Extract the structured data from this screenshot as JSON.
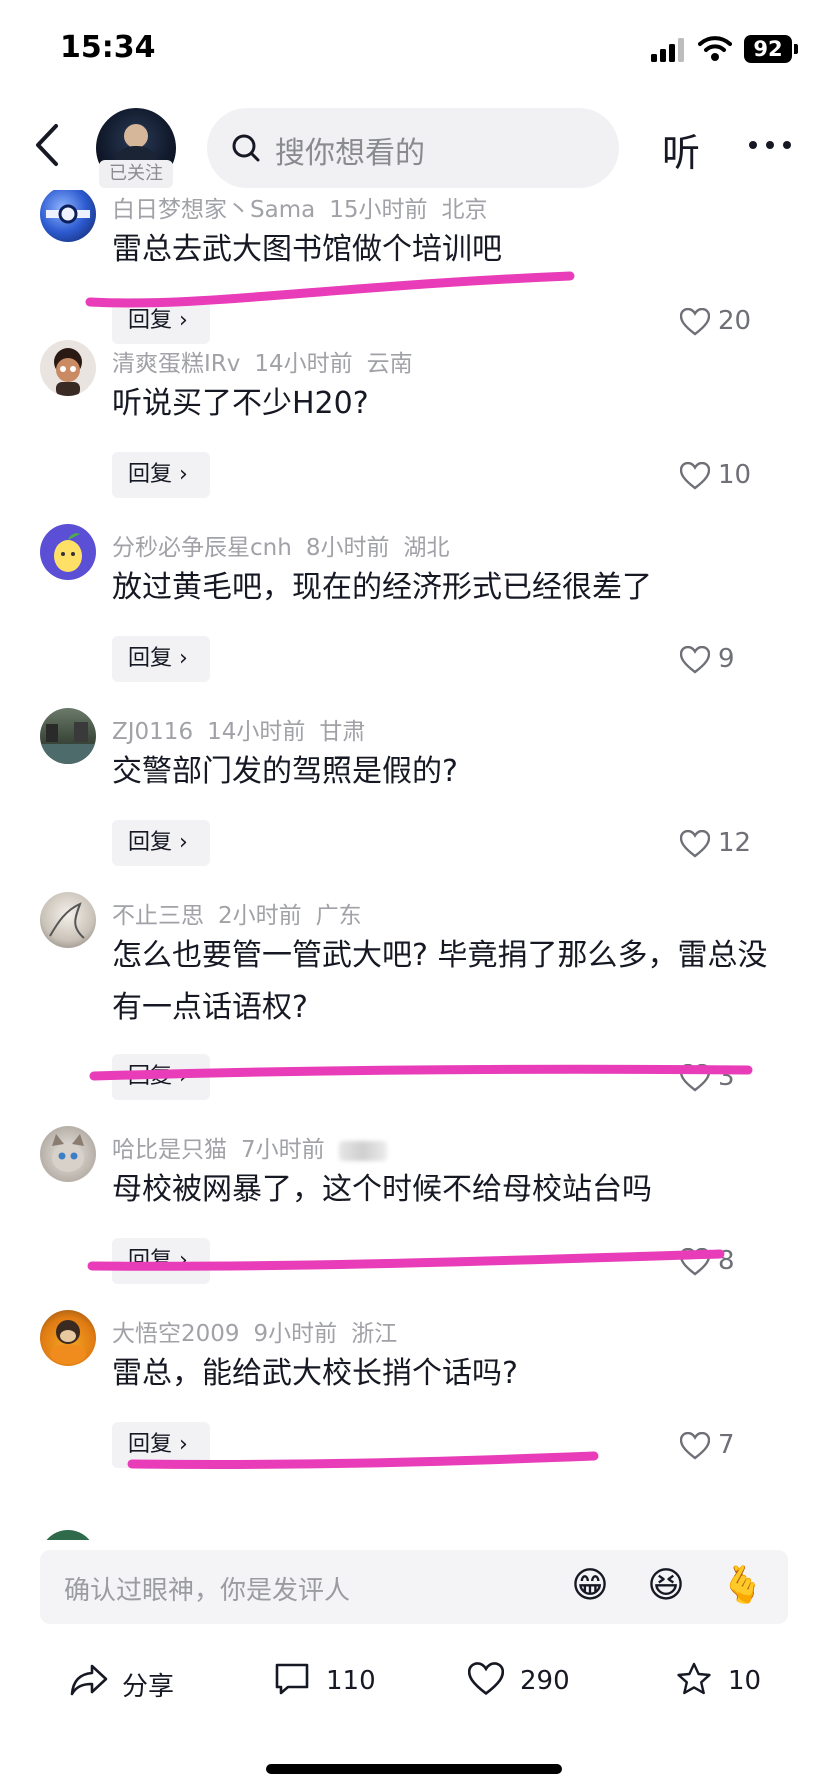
{
  "status_bar": {
    "time": "15:34",
    "battery": "92"
  },
  "nav": {
    "follow_badge": "已关注",
    "search_placeholder": "搜你想看的",
    "listen_label": "听"
  },
  "comments": [
    {
      "user": "白日梦想家丶Sama",
      "time": "15小时前",
      "location": "北京",
      "text": "雷总去武大图书馆做个培训吧",
      "reply": "回复 ›",
      "likes": "20"
    },
    {
      "user": "清爽蛋糕IRv",
      "time": "14小时前",
      "location": "云南",
      "text": "听说买了不少H20?",
      "reply": "回复 ›",
      "likes": "10"
    },
    {
      "user": "分秒必争辰星cnh",
      "time": "8小时前",
      "location": "湖北",
      "text": "放过黄毛吧，现在的经济形式已经很差了",
      "reply": "回复 ›",
      "likes": "9"
    },
    {
      "user": "ZJ0116",
      "time": "14小时前",
      "location": "甘肃",
      "text": "交警部门发的驾照是假的?",
      "reply": "回复 ›",
      "likes": "12"
    },
    {
      "user": "不止三思",
      "time": "2小时前",
      "location": "广东",
      "text": "怎么也要管一管武大吧? 毕竟捐了那么多，雷总没有一点话语权?",
      "reply": "回复 ›",
      "likes": "3"
    },
    {
      "user": "哈比是只猫",
      "time": "7小时前",
      "location": "",
      "text": "母校被网暴了，这个时候不给母校站台吗",
      "reply": "回复 ›",
      "likes": "8"
    },
    {
      "user": "大悟空2009",
      "time": "9小时前",
      "location": "浙江",
      "text": "雷总，能给武大校长捎个话吗?",
      "reply": "回复 ›",
      "likes": "7"
    }
  ],
  "input": {
    "placeholder": "确认过眼神，你是发评人",
    "emojis": [
      "😁",
      "😆",
      "🫰"
    ]
  },
  "actions": {
    "share_label": "分享",
    "comment_count": "110",
    "like_count": "290",
    "favorite_count": "10"
  },
  "colors": {
    "highlight": "#e83cb8",
    "text": "#161823",
    "meta": "#a1a2a7"
  }
}
